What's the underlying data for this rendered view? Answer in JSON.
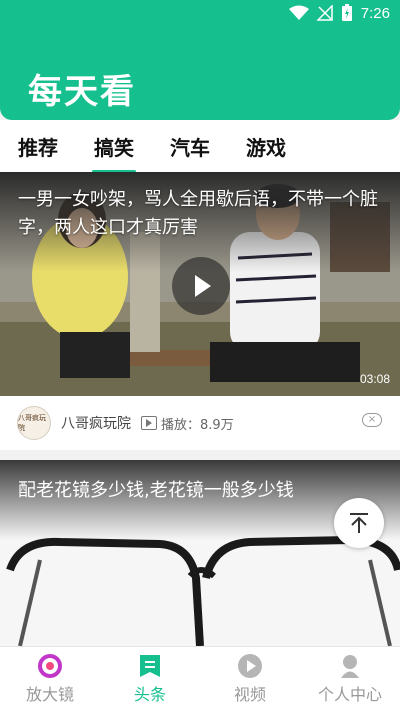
{
  "status_bar": {
    "time": "7:26"
  },
  "app": {
    "title": "每天看",
    "brand_color": "#16c08e"
  },
  "tabs": [
    {
      "label": "推荐",
      "active": false
    },
    {
      "label": "搞笑",
      "active": true
    },
    {
      "label": "汽车",
      "active": false
    },
    {
      "label": "游戏",
      "active": false
    }
  ],
  "feed": [
    {
      "title": "一男一女吵架，骂人全用歇后语，不带一个脏字，两人这口才真厉害",
      "duration": "03:08",
      "author": "八哥疯玩院",
      "avatar_text": "八哥疯玩院",
      "play_label": "播放：8.9万"
    },
    {
      "title": "配老花镜多少钱,老花镜一般多少钱"
    }
  ],
  "bottom_nav": [
    {
      "label": "放大镜",
      "icon": "magnifier-icon",
      "active": false
    },
    {
      "label": "头条",
      "icon": "headline-icon",
      "active": true
    },
    {
      "label": "视频",
      "icon": "video-icon",
      "active": false
    },
    {
      "label": "个人中心",
      "icon": "profile-icon",
      "active": false
    }
  ]
}
